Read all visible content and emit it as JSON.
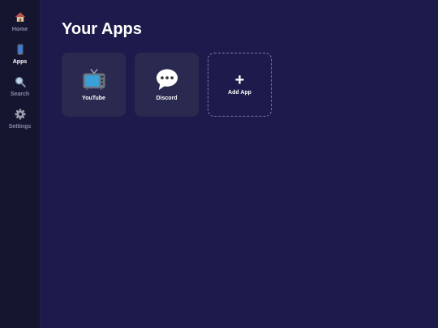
{
  "sidebar": {
    "items": [
      {
        "label": "Home",
        "icon": "home-icon",
        "active": false
      },
      {
        "label": "Apps",
        "icon": "phone-icon",
        "active": true
      },
      {
        "label": "Search",
        "icon": "search-icon",
        "active": false
      },
      {
        "label": "Settings",
        "icon": "gear-icon",
        "active": false
      }
    ]
  },
  "main": {
    "title": "Your Apps",
    "apps": [
      {
        "label": "YouTube",
        "icon": "tv-icon"
      },
      {
        "label": "Discord",
        "icon": "speech-bubble-icon"
      }
    ],
    "add_tile": {
      "glyph": "+",
      "label": "Add App"
    }
  },
  "colors": {
    "background": "#1c1b4b",
    "sidebar": "#15152f",
    "tile": "#2a2950",
    "text_active": "#ffffff",
    "text_muted": "#8a89a8"
  }
}
